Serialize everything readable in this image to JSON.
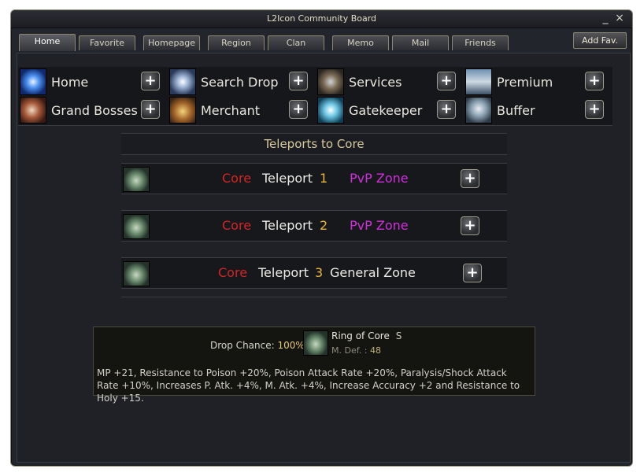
{
  "window": {
    "title": "L2Icon Community Board",
    "minimize": "_",
    "close": "×"
  },
  "tabs": [
    "Home",
    "Favorite",
    "Homepage",
    "Region",
    "Clan",
    "Memo",
    "Mail",
    "Friends"
  ],
  "add_fav": "Add Fav.",
  "menu": [
    {
      "label": "Home",
      "icon": "blue-star-icon"
    },
    {
      "label": "Search Drop",
      "icon": "crystal-burst-icon"
    },
    {
      "label": "Services",
      "icon": "gear-icon"
    },
    {
      "label": "Premium",
      "icon": "sword-altar-icon"
    },
    {
      "label": "Grand Bosses",
      "icon": "dragon-head-icon"
    },
    {
      "label": "Merchant",
      "icon": "treasure-chest-icon"
    },
    {
      "label": "Gatekeeper",
      "icon": "portal-swirl-icon"
    },
    {
      "label": "Buffer",
      "icon": "armored-figure-icon"
    }
  ],
  "plus_symbol": "+",
  "section_title": "Teleports to Core",
  "teleports": [
    {
      "boss": "Core",
      "word": "Teleport",
      "num": "1",
      "zone": "PvP Zone",
      "zone_color": "#d22fdc"
    },
    {
      "boss": "Core",
      "word": "Teleport",
      "num": "2",
      "zone": "PvP Zone",
      "zone_color": "#d22fdc"
    },
    {
      "boss": "Core",
      "word": "Teleport",
      "num": "3",
      "zone": "General Zone",
      "zone_color": "#ecebe6"
    }
  ],
  "drop": {
    "label": "Drop Chance:",
    "chance": "100%",
    "item_name": "Ring of Core",
    "grade": "S",
    "def_label": "M. Def. :",
    "def_value": "48",
    "description": "MP +21, Resistance to Poison +20%, Poison Attack Rate +20%, Paralysis/Shock Attack Rate +10%, Increases P. Atk. +4%, M. Atk. +4%,  Increase Accuracy +2 and Resistance to Holy +15."
  }
}
